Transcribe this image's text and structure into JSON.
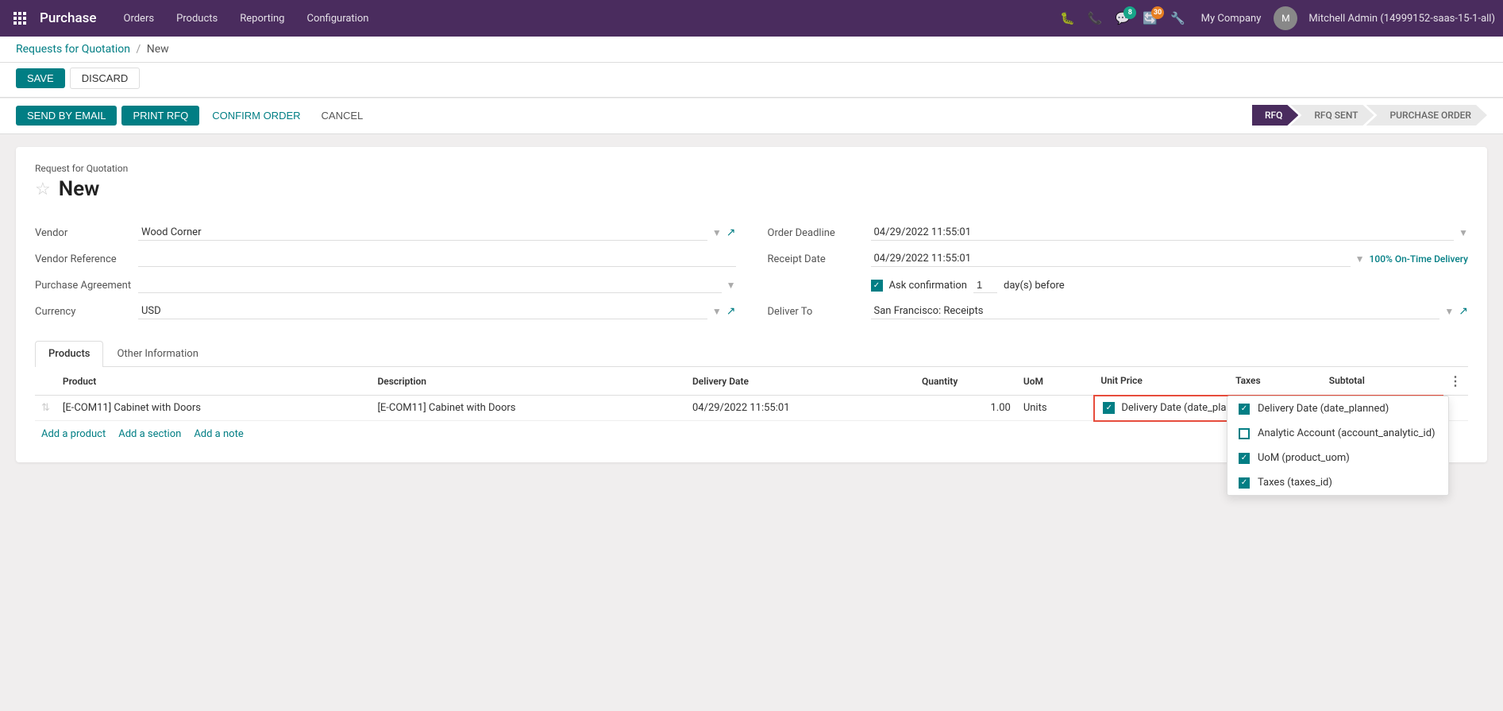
{
  "app": {
    "title": "Purchase",
    "nav_links": [
      "Orders",
      "Products",
      "Reporting",
      "Configuration"
    ]
  },
  "topbar": {
    "icons": [
      "bug",
      "phone",
      "chat",
      "refresh",
      "settings"
    ],
    "chat_badge": "8",
    "refresh_badge": "30",
    "company": "My Company",
    "user_name": "Mitchell Admin (14999152-saas-15-1-all)"
  },
  "breadcrumb": {
    "parent": "Requests for Quotation",
    "separator": "/",
    "current": "New"
  },
  "actions": {
    "save": "SAVE",
    "discard": "DISCARD",
    "send_email": "SEND BY EMAIL",
    "print_rfq": "PRINT RFQ",
    "confirm_order": "CONFIRM ORDER",
    "cancel": "CANCEL"
  },
  "status_steps": [
    {
      "label": "RFQ",
      "active": true
    },
    {
      "label": "RFQ SENT",
      "active": false
    },
    {
      "label": "PURCHASE ORDER",
      "active": false
    }
  ],
  "form": {
    "subtitle": "Request for Quotation",
    "title": "New",
    "fields_left": [
      {
        "label": "Vendor",
        "value": "Wood Corner",
        "type": "select",
        "has_link": true
      },
      {
        "label": "Vendor Reference",
        "value": "",
        "type": "input",
        "has_link": false
      },
      {
        "label": "Purchase Agreement",
        "value": "",
        "type": "select",
        "has_link": false
      },
      {
        "label": "Currency",
        "value": "USD",
        "type": "select",
        "has_link": true
      }
    ],
    "fields_right": [
      {
        "label": "Order Deadline",
        "value": "04/29/2022 11:55:01",
        "type": "datetime",
        "has_link": false
      },
      {
        "label": "Receipt Date",
        "value": "04/29/2022 11:55:01",
        "type": "datetime",
        "has_link": false,
        "badge": "100% On-Time Delivery"
      },
      {
        "label": "Ask confirmation",
        "value": "1",
        "type": "checkbox_num",
        "suffix": "day(s) before"
      },
      {
        "label": "Deliver To",
        "value": "San Francisco: Receipts",
        "type": "select",
        "has_link": true
      }
    ]
  },
  "tabs": [
    {
      "label": "Products",
      "active": true
    },
    {
      "label": "Other Information",
      "active": false
    }
  ],
  "table": {
    "columns": [
      "Product",
      "Description",
      "Delivery Date",
      "Quantity",
      "UoM",
      "Unit Price",
      "Taxes",
      "Subtotal"
    ],
    "rows": [
      {
        "product": "[E-COM11] Cabinet with Doors",
        "description": "[E-COM11] Cabinet with Doors",
        "delivery_date": "04/29/2022 11:55:01",
        "quantity": "1.00",
        "uom": "Units",
        "unit_price": "",
        "taxes": "",
        "subtotal": ""
      }
    ],
    "add_links": [
      "Add a product",
      "Add a section",
      "Add a note"
    ]
  },
  "column_dropdown": {
    "items": [
      {
        "label": "Delivery Date (date_planned)",
        "checked": true
      },
      {
        "label": "Analytic Account (account_analytic_id)",
        "checked": false
      },
      {
        "label": "UoM (product_uom)",
        "checked": true
      },
      {
        "label": "Taxes (taxes_id)",
        "checked": true
      }
    ]
  }
}
